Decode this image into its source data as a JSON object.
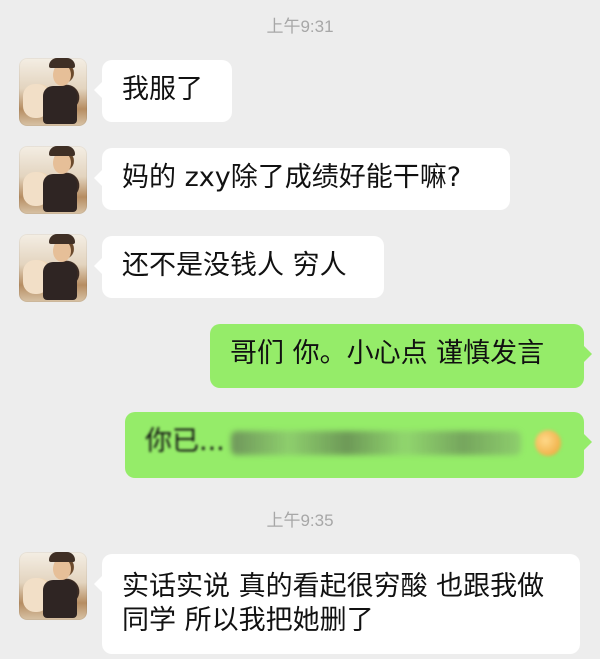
{
  "timestamps": [
    "上午9:31",
    "上午9:35"
  ],
  "messages": [
    {
      "side": "left",
      "text": "我服了"
    },
    {
      "side": "left",
      "text": "妈的 zxy除了成绩好能干嘛?"
    },
    {
      "side": "left",
      "text": "还不是没钱人 穷人"
    },
    {
      "side": "right",
      "text": "哥们 你。小心点 谨慎发言"
    },
    {
      "side": "right",
      "text": "你已..."
    },
    {
      "side": "left",
      "text": "实话实说 真的看起很穷酸 也跟我做同学 所以我把她删了"
    }
  ],
  "colors": {
    "background": "#ededed",
    "left_bubble": "#ffffff",
    "right_bubble": "#95ec69",
    "timestamp": "#a7a7a7"
  }
}
